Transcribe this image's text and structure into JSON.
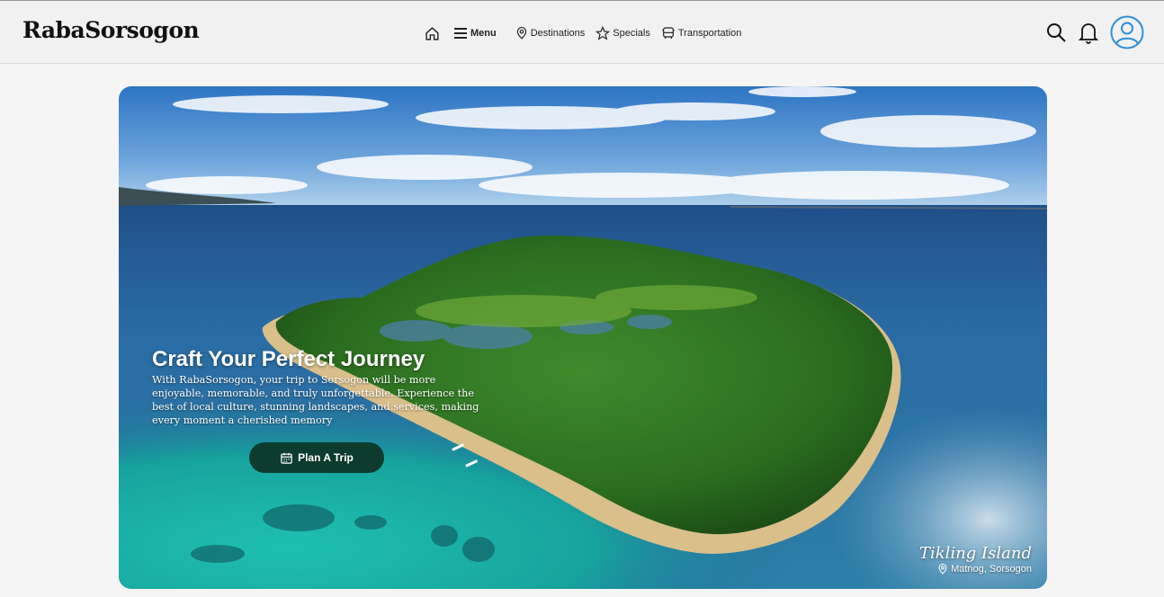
{
  "header": {
    "logo": "RabaSorsogon",
    "nav": {
      "menu": "Menu",
      "destinations": "Destinations",
      "specials": "Specials",
      "transportation": "Transportation"
    }
  },
  "hero": {
    "title": "Craft Your Perfect Journey",
    "description": "With RabaSorsogon, your trip to Sorsogon will be more enjoyable, memorable, and truly unforgettable. Experience the best of local culture, stunning landscapes, and services, making every moment a cherished memory",
    "cta_label": "Plan A Trip",
    "location_name": "Tikling Island",
    "location_place": "Matnog, Sorsogon"
  },
  "colors": {
    "button_bg": "#0d3b2e",
    "profile_accent": "#2f8fd8"
  }
}
